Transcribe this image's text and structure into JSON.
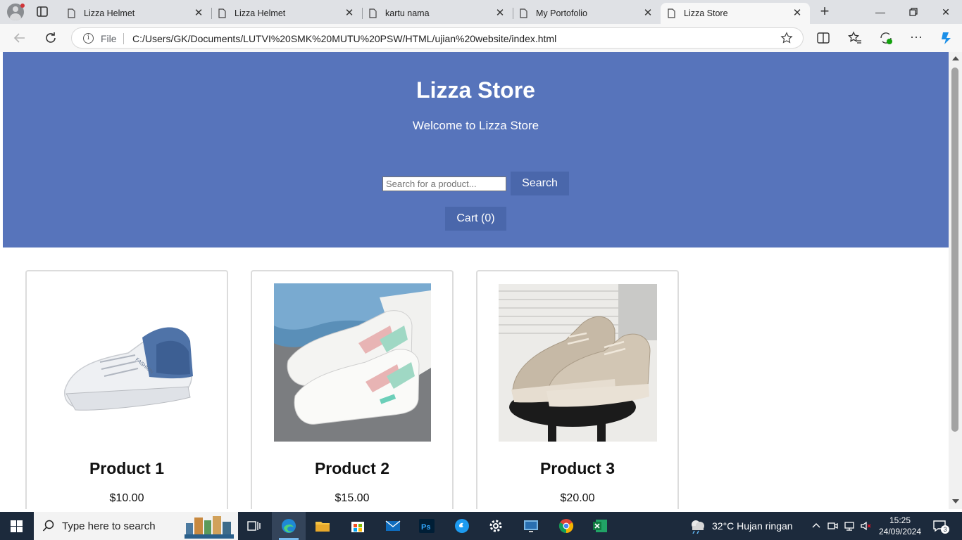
{
  "browser": {
    "tabs": [
      {
        "label": "Lizza Helmet",
        "active": false
      },
      {
        "label": "Lizza Helmet",
        "active": false
      },
      {
        "label": "kartu nama",
        "active": false
      },
      {
        "label": "My Portofolio",
        "active": false
      },
      {
        "label": "Lizza Store",
        "active": true
      }
    ],
    "address": {
      "scheme_label": "File",
      "url": "C:/Users/GK/Documents/LUTVI%20SMK%20MUTU%20PSW/HTML/ujian%20website/index.html"
    },
    "accent": "#5774bb"
  },
  "page": {
    "title": "Lizza Store",
    "subtitle": "Welcome to Lizza Store",
    "search": {
      "placeholder": "Search for a product...",
      "value": "",
      "button_label": "Search"
    },
    "cart_label": "Cart (0)",
    "products": [
      {
        "name": "Product 1",
        "price": "$10.00",
        "image": "white-blue-sneaker-image"
      },
      {
        "name": "Product 2",
        "price": "$15.00",
        "image": "white-mint-sneakers-image"
      },
      {
        "name": "Product 3",
        "price": "$20.00",
        "image": "beige-sneakers-image"
      }
    ]
  },
  "taskbar": {
    "search_placeholder": "Type here to search",
    "apps": [
      "task-view-icon",
      "edge-icon",
      "file-explorer-icon",
      "store-icon",
      "mail-icon",
      "photoshop-icon",
      "app-icon",
      "settings-icon",
      "remote-desktop-icon",
      "chrome-icon",
      "excel-icon"
    ],
    "weather": {
      "temp": "32°C",
      "condition": "Hujan ringan"
    },
    "clock": {
      "time": "15:25",
      "date": "24/09/2024"
    },
    "notification_count": "3"
  }
}
